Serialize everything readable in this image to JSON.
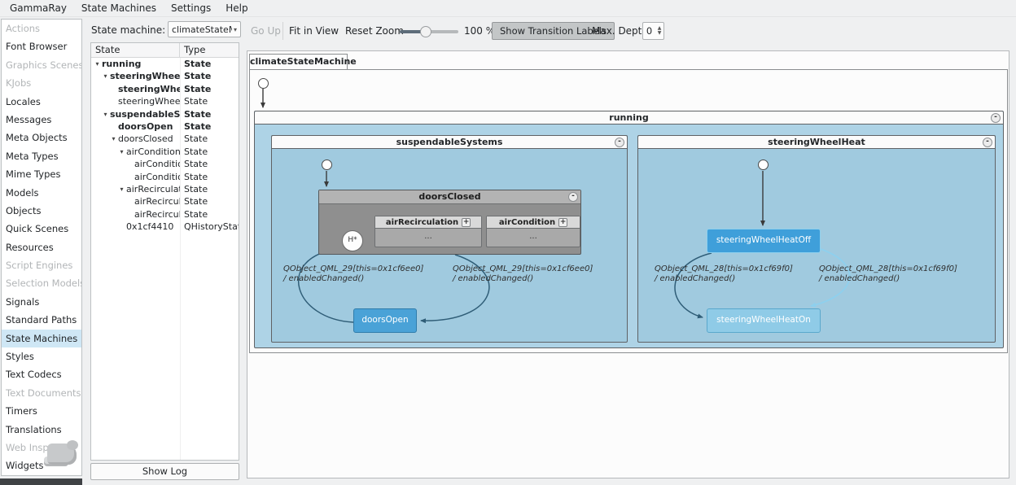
{
  "menubar": {
    "items": [
      "GammaRay",
      "State Machines",
      "Settings",
      "Help"
    ]
  },
  "sidebar": {
    "items": [
      {
        "label": "Actions",
        "enabled": false,
        "selected": false
      },
      {
        "label": "Font Browser",
        "enabled": true,
        "selected": false
      },
      {
        "label": "Graphics Scenes",
        "enabled": false,
        "selected": false
      },
      {
        "label": "KJobs",
        "enabled": false,
        "selected": false
      },
      {
        "label": "Locales",
        "enabled": true,
        "selected": false
      },
      {
        "label": "Messages",
        "enabled": true,
        "selected": false
      },
      {
        "label": "Meta Objects",
        "enabled": true,
        "selected": false
      },
      {
        "label": "Meta Types",
        "enabled": true,
        "selected": false
      },
      {
        "label": "Mime Types",
        "enabled": true,
        "selected": false
      },
      {
        "label": "Models",
        "enabled": true,
        "selected": false
      },
      {
        "label": "Objects",
        "enabled": true,
        "selected": false
      },
      {
        "label": "Quick Scenes",
        "enabled": true,
        "selected": false
      },
      {
        "label": "Resources",
        "enabled": true,
        "selected": false
      },
      {
        "label": "Script Engines",
        "enabled": false,
        "selected": false
      },
      {
        "label": "Selection Models",
        "enabled": false,
        "selected": false
      },
      {
        "label": "Signals",
        "enabled": true,
        "selected": false
      },
      {
        "label": "Standard Paths",
        "enabled": true,
        "selected": false
      },
      {
        "label": "State Machines",
        "enabled": true,
        "selected": true
      },
      {
        "label": "Styles",
        "enabled": true,
        "selected": false
      },
      {
        "label": "Text Codecs",
        "enabled": true,
        "selected": false
      },
      {
        "label": "Text Documents",
        "enabled": false,
        "selected": false
      },
      {
        "label": "Timers",
        "enabled": true,
        "selected": false
      },
      {
        "label": "Translations",
        "enabled": true,
        "selected": false
      },
      {
        "label": "Web Inspector",
        "enabled": false,
        "selected": false
      },
      {
        "label": "Widgets",
        "enabled": true,
        "selected": false
      }
    ]
  },
  "machine_selector": {
    "label": "State machine:",
    "value": "climateStateMachine"
  },
  "toolbar": {
    "go_up": "Go Up",
    "fit_in_view": "Fit in View",
    "reset_zoom": "Reset Zoom",
    "zoom_value": "100 %",
    "show_transition_labels": "Show Transition Labels",
    "max_depth_label": "Max. Depth:",
    "max_depth_value": "0"
  },
  "tree": {
    "columns": [
      "State",
      "Type"
    ],
    "rows": [
      {
        "label": "running",
        "type": "State",
        "depth": 0,
        "bold": true,
        "expander": true
      },
      {
        "label": "steeringWheel...",
        "type": "State",
        "depth": 1,
        "bold": true,
        "expander": true
      },
      {
        "label": "steeringWhe...",
        "type": "State",
        "depth": 2,
        "bold": true,
        "expander": false
      },
      {
        "label": "steeringWheelH...",
        "type": "State",
        "depth": 2,
        "bold": false,
        "expander": false
      },
      {
        "label": "suspendableS...",
        "type": "State",
        "depth": 1,
        "bold": true,
        "expander": true
      },
      {
        "label": "doorsOpen",
        "type": "State",
        "depth": 2,
        "bold": true,
        "expander": false
      },
      {
        "label": "doorsClosed",
        "type": "State",
        "depth": 2,
        "bold": false,
        "expander": true
      },
      {
        "label": "airCondition",
        "type": "State",
        "depth": 3,
        "bold": false,
        "expander": true
      },
      {
        "label": "airConditionOff",
        "type": "State",
        "depth": 4,
        "bold": false,
        "expander": false
      },
      {
        "label": "airConditionOn",
        "type": "State",
        "depth": 4,
        "bold": false,
        "expander": false
      },
      {
        "label": "airRecirculation",
        "type": "State",
        "depth": 3,
        "bold": false,
        "expander": true
      },
      {
        "label": "airRecirculat...",
        "type": "State",
        "depth": 4,
        "bold": false,
        "expander": false
      },
      {
        "label": "airRecirculat...",
        "type": "State",
        "depth": 4,
        "bold": false,
        "expander": false
      },
      {
        "label": "0x1cf4410",
        "type": "QHistoryState",
        "depth": 3,
        "bold": false,
        "expander": false
      }
    ]
  },
  "footer": {
    "show_log": "Show Log"
  },
  "diagram": {
    "machine_tab": "climateStateMachine",
    "states": {
      "running": "running",
      "suspendableSystems": "suspendableSystems",
      "steeringWheelHeat": "steeringWheelHeat",
      "doorsClosed": "doorsClosed",
      "airRecirculation": "airRecirculation",
      "airCondition": "airCondition",
      "doorsOpen": "doorsOpen",
      "steeringWheelHeatOff": "steeringWheelHeatOff",
      "steeringWheelHeatOn": "steeringWheelHeatOn"
    },
    "glyphs": {
      "collapse": "-",
      "expand": "+",
      "history": "H*",
      "ellipsis": "..."
    },
    "transitions": {
      "susp_left": {
        "line1": "QObject_QML_29[this=0x1cf6ee0]",
        "line2": "/ enabledChanged()"
      },
      "susp_right": {
        "line1": "QObject_QML_29[this=0x1cf6ee0]",
        "line2": "/ enabledChanged()"
      },
      "steer_left": {
        "line1": "QObject_QML_28[this=0x1cf69f0]",
        "line2": "/ enabledChanged()"
      },
      "steer_right": {
        "line1": "QObject_QML_28[this=0x1cf69f0]",
        "line2": "/ enabledChanged()"
      }
    },
    "colors": {
      "running_fill": "#aed3e6",
      "inner_fill": "#a0cadf",
      "gray_state": "#8f8f8f",
      "doors_open_fill": "#4aa2d7",
      "heat_off_fill": "#3f9fda",
      "heat_on_fill": "#8fcbe7",
      "transition_dark": "#2f5d77",
      "transition_light": "#8ed0ee",
      "selection": "#cfe7f5"
    }
  }
}
